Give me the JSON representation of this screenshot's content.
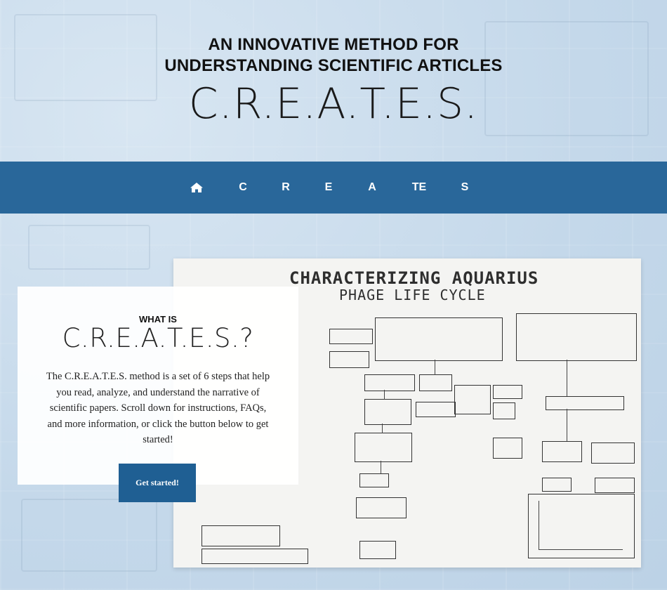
{
  "hero": {
    "line1": "AN INNOVATIVE METHOD FOR",
    "line2": "UNDERSTANDING SCIENTIFIC ARTICLES",
    "acronym": "C.R.E.A.T.E.S."
  },
  "nav": {
    "home_icon": "home-icon",
    "items": [
      "C",
      "R",
      "E",
      "A",
      "TE",
      "S"
    ]
  },
  "card": {
    "kicker": "WHAT IS",
    "title": "C.R.E.A.T.E.S.?",
    "body": "The C.R.E.A.T.E.S. method is a set of 6 steps that help you read, analyze, and understand the narrative of scientific papers. Scroll down for instructions, FAQs, and more information, or click the button below to get started!",
    "button": "Get started!"
  },
  "poster": {
    "title": "CHARACTERIZING AQUARIUS",
    "subtitle": "PHAGE LIFE CYCLE"
  },
  "colors": {
    "nav_bg": "#29679a",
    "button_bg": "#1f5f93",
    "page_bg": "#c9dced"
  }
}
